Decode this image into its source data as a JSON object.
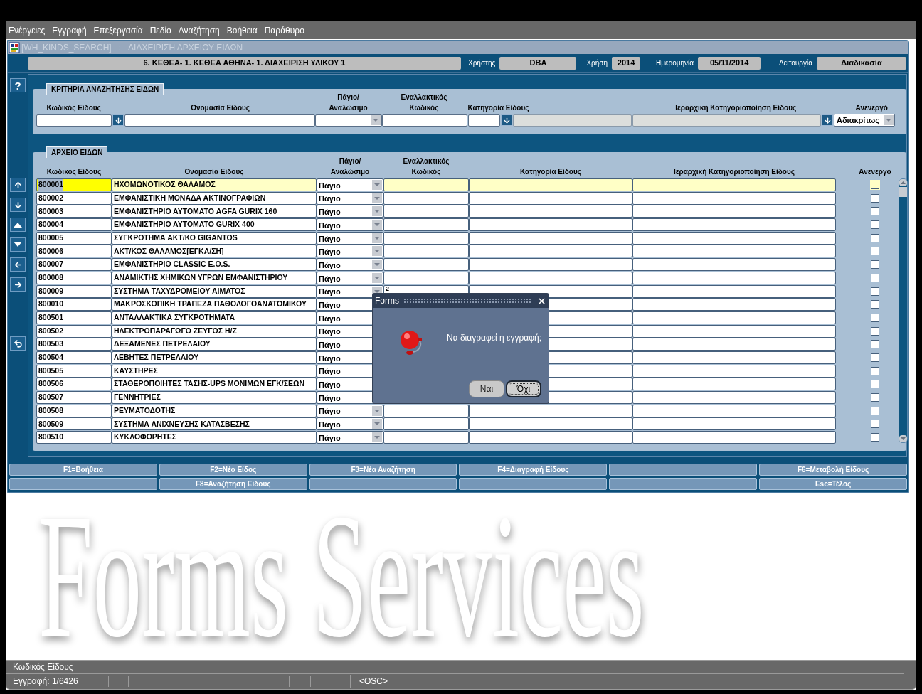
{
  "menu": [
    "Ενέργειες",
    "Εγγραφή",
    "Επεξεργασία",
    "Πεδίο",
    "Αναζήτηση",
    "Βοήθεια",
    "Παράθυρο"
  ],
  "window": {
    "title": "[WH_KINDS_SEARCH]   :   ΔΙΑΧΕΙΡΙΣΗ ΑΡΧΕΙΟΥ ΕΙΔΩΝ"
  },
  "header": {
    "org": "6. ΚΕΘΕΑ- 1. ΚΕΘΕΑ ΑΘΗΝΑ- 1. ΔΙΑΧΕΙΡΙΣΗ ΥΛΙΚΟΥ 1",
    "fields": [
      {
        "label": "Χρήστης",
        "value": "DBA"
      },
      {
        "label": "Χρήση",
        "value": "2014"
      },
      {
        "label": "Ημερομηνία",
        "value": "05/11/2014"
      },
      {
        "label": "Λειτουργία",
        "value": "Διαδικασία"
      }
    ]
  },
  "help_button": "?",
  "search": {
    "title": "ΚΡΙΤΗΡΙΑ ΑΝΑΖΗΤΗΣΗΣ ΕΙΔΩΝ",
    "columns": [
      "Κωδικός Είδους",
      "Ονομασία Είδους",
      "Πάγιο/\nΑναλώσιμο",
      "Εναλλακτικός\nΚωδικός",
      "Κατηγορία Είδους",
      "Ιεραρχική Κατηγοριοποίηση Είδους",
      "Ανενεργό"
    ],
    "inactive_value": "Αδιακρίτως"
  },
  "table": {
    "title": "ΑΡΧΕΙΟ ΕΙΔΩΝ",
    "columns": [
      "Κωδικός Είδους",
      "Ονομασία Είδους",
      "Πάγιο/\nΑναλώσιμο",
      "Εναλλακτικός\nΚωδικός",
      "Κατηγορία Είδους",
      "Ιεραρχική Κατηγοριοποίηση Είδους",
      "Ανενεργό"
    ],
    "rows": [
      {
        "code": "800001",
        "name": "ΗΧΟΜΩΝΟΤΙΚΟΣ ΘΑΛΑΜΟΣ",
        "type": "Πάγιο",
        "selected": true,
        "inactive": false
      },
      {
        "code": "800002",
        "name": "ΕΜΦΑΝΙΣΤΙΚΗ ΜΟΝΑΔΑ ΑΚΤΙΝΟΓΡΑΦΙΩΝ",
        "type": "Πάγιο",
        "selected": false,
        "inactive": false
      },
      {
        "code": "800003",
        "name": "ΕΜΦΑΝΙΣΤΗΡΙΟ ΑΥΤΟΜΑΤΟ AGFA GURIX 160",
        "type": "Πάγιο",
        "selected": false,
        "inactive": false
      },
      {
        "code": "800004",
        "name": "ΕΜΦΑΝΙΣΤΗΡΙΟ ΑΥΤΟΜΑΤΟ GURIX 400",
        "type": "Πάγιο",
        "selected": false,
        "inactive": false
      },
      {
        "code": "800005",
        "name": "ΣΥΓΚΡΟΤΗΜΑ ΑΚΤ/ΚΟ GIGANTOS",
        "type": "Πάγιο",
        "selected": false,
        "inactive": false
      },
      {
        "code": "800006",
        "name": "ΑΚΤ/ΚΟΣ ΘΑΛΑΜΟΣ[ΕΓΚΑ/ΣΗ]",
        "type": "Πάγιο",
        "selected": false,
        "inactive": false
      },
      {
        "code": "800007",
        "name": "ΕΜΦΑΝΙΣΤΗΡΙΟ CLASSIC E.O.S.",
        "type": "Πάγιο",
        "selected": false,
        "inactive": false
      },
      {
        "code": "800008",
        "name": "ΑΝΑΜΙΚΤΗΣ ΧΗΜΙΚΩΝ ΥΓΡΩΝ ΕΜΦΑΝΙΣΤΗΡΙΟΥ",
        "type": "Πάγιο",
        "selected": false,
        "inactive": false
      },
      {
        "code": "800009",
        "name": "ΣΥΣΤΗΜΑ ΤΑΧΥΔΡΟΜΕΙΟΥ ΑΙΜΑΤΟΣ",
        "type": "Πάγιο",
        "alt_code": "2",
        "selected": false,
        "inactive": false
      },
      {
        "code": "800010",
        "name": "ΜΑΚΡΟΣΚΟΠΙΚΗ ΤΡΑΠΕΖΑ ΠΑΘΟΛΟΓΟΑΝΑΤΟΜΙΚΟΥ",
        "type": "Πάγιο",
        "selected": false,
        "inactive": false
      },
      {
        "code": "800501",
        "name": "ΑΝΤΑΛΛΑΚΤΙΚΑ ΣΥΓΚΡΟΤΗΜΑΤΑ",
        "type": "Πάγιο",
        "selected": false,
        "inactive": false
      },
      {
        "code": "800502",
        "name": "ΗΛΕΚΤΡΟΠΑΡΑΓΩΓΟ ΖΕΥΓΟΣ Η/Ζ",
        "type": "Πάγιο",
        "selected": false,
        "inactive": false
      },
      {
        "code": "800503",
        "name": "ΔΕΞΑΜΕΝΕΣ ΠΕΤΡΕΛΑΙΟΥ",
        "type": "Πάγιο",
        "selected": false,
        "inactive": false
      },
      {
        "code": "800504",
        "name": "ΛΕΒΗΤΕΣ ΠΕΤΡΕΛΑΙΟΥ",
        "type": "Πάγιο",
        "selected": false,
        "inactive": false
      },
      {
        "code": "800505",
        "name": "ΚΑΥΣΤΗΡΕΣ",
        "type": "Πάγιο",
        "selected": false,
        "inactive": false
      },
      {
        "code": "800506",
        "name": "ΣΤΑΘΕΡΟΠΟΙΗΤΕΣ ΤΑΣΗΣ-UPS ΜΟΝΙΜΩΝ ΕΓΚ/ΣΕΩΝ",
        "type": "Πάγιο",
        "selected": false,
        "inactive": false
      },
      {
        "code": "800507",
        "name": "ΓΕΝΝΗΤΡΙΕΣ",
        "type": "Πάγιο",
        "selected": false,
        "inactive": false
      },
      {
        "code": "800508",
        "name": "ΡΕΥΜΑΤΟΔΟΤΗΣ",
        "type": "Πάγιο",
        "selected": false,
        "inactive": false
      },
      {
        "code": "800509",
        "name": "ΣΥΣΤΗΜΑ ΑΝΙΧΝΕΥΣΗΣ ΚΑΤΑΣΒΕΣΗΣ",
        "type": "Πάγιο",
        "selected": false,
        "inactive": false
      },
      {
        "code": "800510",
        "name": "ΚΥΚΛΟΦΟΡΗΤΕΣ",
        "type": "Πάγιο",
        "selected": false,
        "inactive": false
      }
    ]
  },
  "function_keys": [
    {
      "kind": "key",
      "label": "F1=Βοήθεια"
    },
    {
      "kind": "key",
      "label": "F2=Νέο Είδος"
    },
    {
      "kind": "key",
      "label": "F3=Νέα Αναζήτηση"
    },
    {
      "kind": "key",
      "label": "F4=Διαγραφή Είδους"
    },
    {
      "kind": "blank"
    },
    {
      "kind": "key",
      "label": "F6=Μεταβολή Είδους"
    },
    {
      "kind": "blank"
    },
    {
      "kind": "key",
      "label": "F8=Αναζήτηση Είδους"
    },
    {
      "kind": "blank"
    },
    {
      "kind": "blank"
    },
    {
      "kind": "blank"
    },
    {
      "kind": "key",
      "label": "Esc=Τέλος"
    }
  ],
  "background_logo": "Forms Services",
  "dialog": {
    "title": "Forms",
    "message": "Να διαγραφεί η εγγραφή;",
    "buttons": [
      {
        "label": "Ναι",
        "selected": false
      },
      {
        "label": "Όχι",
        "selected": true
      }
    ]
  },
  "status_bar": {
    "hint": "Κωδικός Είδους",
    "record": "Εγγραφή: 1/6426",
    "mode": "<OSC>"
  }
}
